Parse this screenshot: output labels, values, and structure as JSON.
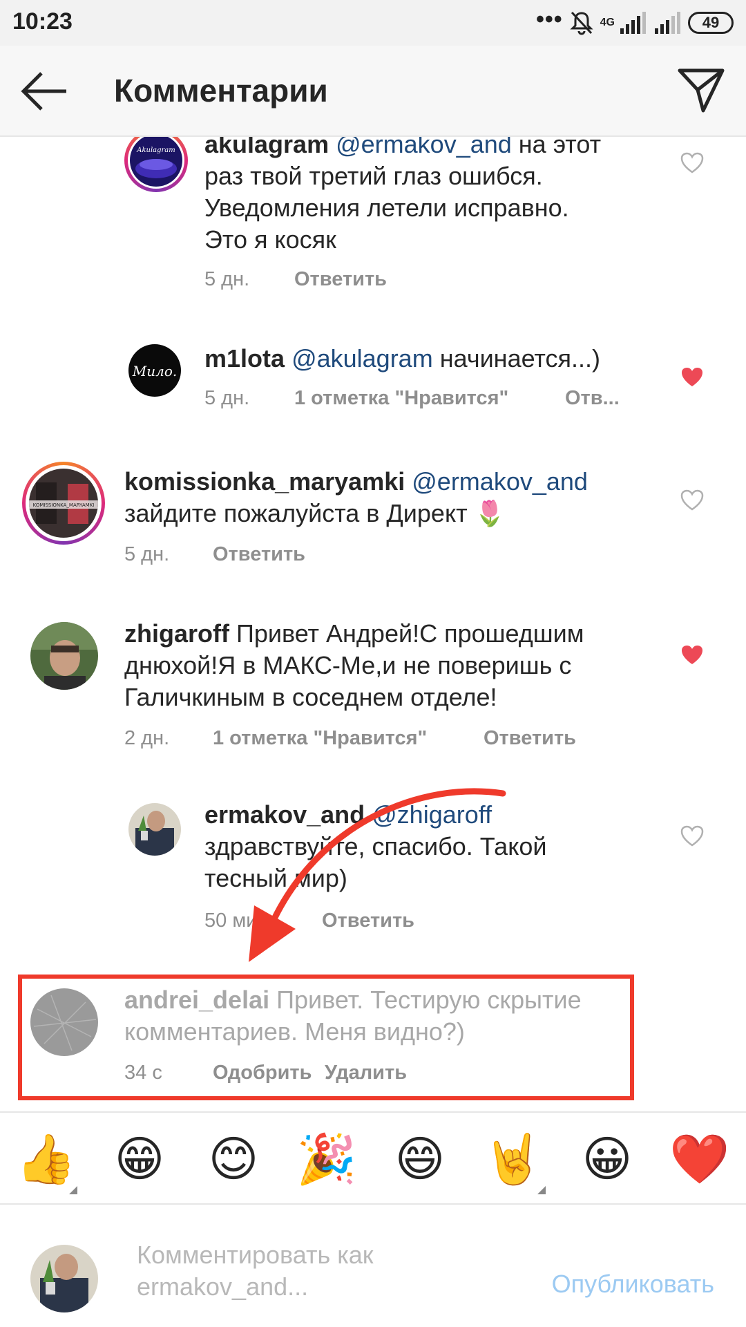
{
  "status": {
    "time": "10:23",
    "network": "4G",
    "battery": "49"
  },
  "header": {
    "title": "Комментарии"
  },
  "comments": [
    {
      "user": "akulagram",
      "mention": "@ermakov_and",
      "text_line1": " на этот",
      "lines": [
        "раз твой третий глаз ошибся.",
        "Уведомления летели исправно.",
        "Это я косяк"
      ],
      "time": "5 дн.",
      "reply": "Ответить",
      "avatar_text": "Akulagram",
      "liked": false
    },
    {
      "user": "m1lota",
      "mention": "@akulagram",
      "text_line1": " начинается...)",
      "lines": [],
      "time": "5 дн.",
      "likes": "1 отметка \"Нравится\"",
      "reply": "Отв...",
      "avatar_text": "Мило.",
      "liked": true
    },
    {
      "user": "komissionka_maryamki",
      "mention": "@ermakov_and",
      "text_line1": "",
      "lines": [
        "зайдите пожалуйста в Директ 🌷"
      ],
      "time": "5 дн.",
      "reply": "Ответить",
      "avatar_text": "KOMISSIONKA_MARYAMKI",
      "liked": false
    },
    {
      "user": "zhigaroff",
      "mention": "",
      "text_line1": " Привет Андрей!С прошедшим",
      "lines": [
        "днюхой!Я в МАКС-Ме,и не поверишь с",
        "Галичкиным в соседнем отделе!"
      ],
      "time": "2 дн.",
      "likes": "1 отметка \"Нравится\"",
      "reply": "Ответить",
      "liked": true
    },
    {
      "user": "ermakov_and",
      "mention": "@zhigaroff",
      "text_line1": "",
      "lines": [
        "здравствуйте, спасибо. Такой",
        "тесный мир)"
      ],
      "time": "50 мин.",
      "reply": "Ответить",
      "liked": false
    },
    {
      "user": "andrei_delai",
      "text_line1": " Привет. Тестирую скрытие",
      "lines": [
        "комментариев. Меня видно?)"
      ],
      "time": "34 с",
      "approve": "Одобрить",
      "delete": "Удалить",
      "hidden": true
    }
  ],
  "emojis": [
    "👍",
    "😁",
    "😊",
    "🎉",
    "😄",
    "🤘",
    "😀",
    "❤️"
  ],
  "composer": {
    "placeholder_line1": "Комментировать как",
    "placeholder_line2": "ermakov_and...",
    "publish": "Опубликовать"
  },
  "colors": {
    "accent_red": "#ef3a2b",
    "mention": "#1f4a7c",
    "heart_red": "#ed4956",
    "publish_disabled": "#9ccaf2"
  }
}
